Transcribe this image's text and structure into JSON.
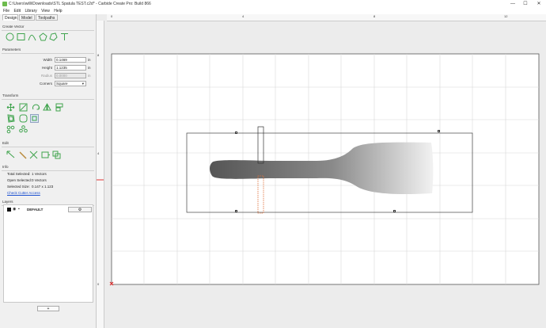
{
  "window": {
    "title": "C:\\Users\\willi\\Downloads\\STL Spatula TEST.c2d* - Carbide Create Pro: Build 866",
    "minimize": "—",
    "maximize": "☐",
    "close": "✕"
  },
  "menu": [
    "File",
    "Edit",
    "Library",
    "View",
    "Help"
  ],
  "tabs": [
    "Design",
    "Model",
    "Toolpaths"
  ],
  "sections": {
    "create_vector": "Create Vector",
    "parameters": "Parameters",
    "transform": "Transform",
    "edit": "Edit",
    "info": "Info",
    "layers": "Layers"
  },
  "parameters": {
    "width_label": "Width",
    "width_value": "0.1469",
    "width_unit": "in",
    "height_label": "Height",
    "height_value": "1.1235",
    "height_unit": "in",
    "radius_label": "Radius",
    "radius_value": "0.0000",
    "radius_unit": "in",
    "corners_label": "Corners",
    "corners_value": "Square"
  },
  "info": {
    "total_selected_label": "Total Selected:",
    "total_selected_value": "1 Vectors",
    "open_selected_label": "Open Selected:",
    "open_selected_value": "0 Vectors",
    "selected_size_label": "Selected Size:",
    "selected_size_value": "0.147 x 1.123",
    "check_cutter_link": "Check Cutter Access"
  },
  "layers": {
    "name": "DEFAULT",
    "gear": "⚙",
    "add": "+",
    "swatch_color": "#111111"
  },
  "rulers": {
    "top": [
      "0",
      "4",
      "8",
      "12"
    ],
    "left": [
      "8",
      "4",
      "0"
    ]
  },
  "accent_color": "#3fa34d",
  "selection_color": "#e0703a"
}
